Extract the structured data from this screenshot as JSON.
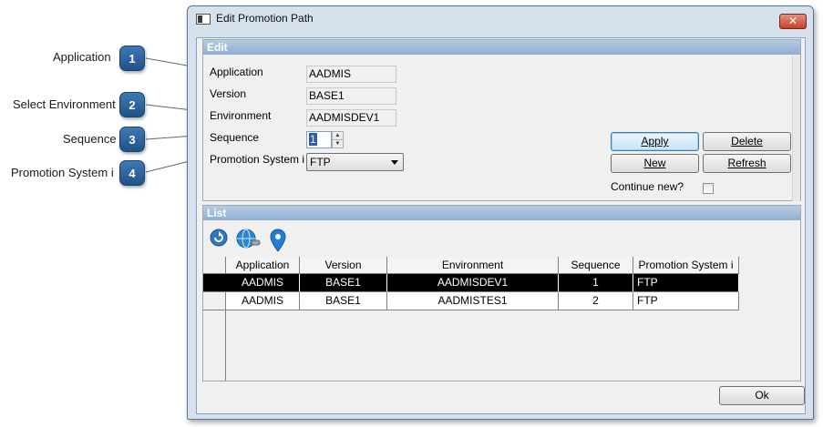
{
  "callouts": [
    {
      "label": "Application",
      "number": "1"
    },
    {
      "label": "Select Environment",
      "number": "2"
    },
    {
      "label": "Sequence",
      "number": "3"
    },
    {
      "label": "Promotion System i",
      "number": "4"
    }
  ],
  "window": {
    "title": "Edit Promotion Path",
    "close_glyph": "✕"
  },
  "edit": {
    "header": "Edit",
    "application_label": "Application",
    "application_value": "AADMIS",
    "version_label": "Version",
    "version_value": "BASE1",
    "environment_label": "Environment",
    "environment_value": "AADMISDEV1",
    "sequence_label": "Sequence",
    "sequence_value": "1",
    "promotion_label": "Promotion System i",
    "promotion_value": "FTP",
    "continue_label": "Continue new?",
    "continue_checked": false
  },
  "buttons": {
    "apply": "Apply",
    "delete": "Delete",
    "new": "New",
    "refresh": "Refresh",
    "ok": "Ok"
  },
  "list": {
    "header": "List",
    "toolbar_icons": [
      "refresh-icon",
      "globe-connect-icon",
      "location-pin-icon"
    ],
    "columns": [
      "Application",
      "Version",
      "Environment",
      "Sequence",
      "Promotion System i"
    ],
    "rows": [
      [
        "AADMIS",
        "BASE1",
        "AADMISDEV1",
        "1",
        "FTP"
      ],
      [
        "AADMIS",
        "BASE1",
        "AADMISTES1",
        "2",
        "FTP"
      ]
    ],
    "selected_row": 0
  },
  "colors": {
    "callout": "#2a5f96",
    "header": "#a3bddc",
    "selection": "#000000"
  }
}
